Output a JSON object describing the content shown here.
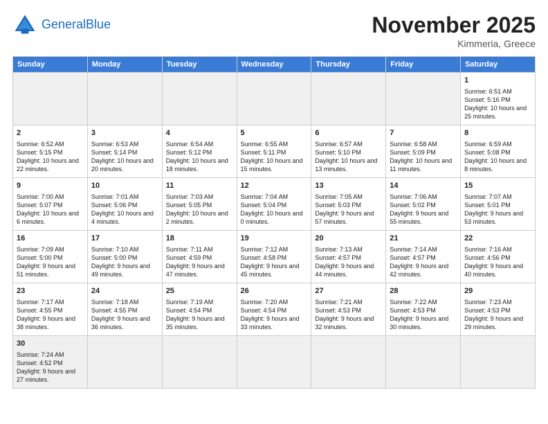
{
  "header": {
    "logo_general": "General",
    "logo_blue": "Blue",
    "month": "November 2025",
    "location": "Kimmeria, Greece"
  },
  "days_of_week": [
    "Sunday",
    "Monday",
    "Tuesday",
    "Wednesday",
    "Thursday",
    "Friday",
    "Saturday"
  ],
  "weeks": [
    [
      {
        "day": "",
        "info": "",
        "empty": true
      },
      {
        "day": "",
        "info": "",
        "empty": true
      },
      {
        "day": "",
        "info": "",
        "empty": true
      },
      {
        "day": "",
        "info": "",
        "empty": true
      },
      {
        "day": "",
        "info": "",
        "empty": true
      },
      {
        "day": "",
        "info": "",
        "empty": true
      },
      {
        "day": "1",
        "info": "Sunrise: 6:51 AM\nSunset: 5:16 PM\nDaylight: 10 hours\nand 25 minutes."
      }
    ],
    [
      {
        "day": "2",
        "info": "Sunrise: 6:52 AM\nSunset: 5:15 PM\nDaylight: 10 hours\nand 22 minutes."
      },
      {
        "day": "3",
        "info": "Sunrise: 6:53 AM\nSunset: 5:14 PM\nDaylight: 10 hours\nand 20 minutes."
      },
      {
        "day": "4",
        "info": "Sunrise: 6:54 AM\nSunset: 5:12 PM\nDaylight: 10 hours\nand 18 minutes."
      },
      {
        "day": "5",
        "info": "Sunrise: 6:55 AM\nSunset: 5:11 PM\nDaylight: 10 hours\nand 15 minutes."
      },
      {
        "day": "6",
        "info": "Sunrise: 6:57 AM\nSunset: 5:10 PM\nDaylight: 10 hours\nand 13 minutes."
      },
      {
        "day": "7",
        "info": "Sunrise: 6:58 AM\nSunset: 5:09 PM\nDaylight: 10 hours\nand 11 minutes."
      },
      {
        "day": "8",
        "info": "Sunrise: 6:59 AM\nSunset: 5:08 PM\nDaylight: 10 hours\nand 8 minutes."
      }
    ],
    [
      {
        "day": "9",
        "info": "Sunrise: 7:00 AM\nSunset: 5:07 PM\nDaylight: 10 hours\nand 6 minutes."
      },
      {
        "day": "10",
        "info": "Sunrise: 7:01 AM\nSunset: 5:06 PM\nDaylight: 10 hours\nand 4 minutes."
      },
      {
        "day": "11",
        "info": "Sunrise: 7:03 AM\nSunset: 5:05 PM\nDaylight: 10 hours\nand 2 minutes."
      },
      {
        "day": "12",
        "info": "Sunrise: 7:04 AM\nSunset: 5:04 PM\nDaylight: 10 hours\nand 0 minutes."
      },
      {
        "day": "13",
        "info": "Sunrise: 7:05 AM\nSunset: 5:03 PM\nDaylight: 9 hours\nand 57 minutes."
      },
      {
        "day": "14",
        "info": "Sunrise: 7:06 AM\nSunset: 5:02 PM\nDaylight: 9 hours\nand 55 minutes."
      },
      {
        "day": "15",
        "info": "Sunrise: 7:07 AM\nSunset: 5:01 PM\nDaylight: 9 hours\nand 53 minutes."
      }
    ],
    [
      {
        "day": "16",
        "info": "Sunrise: 7:09 AM\nSunset: 5:00 PM\nDaylight: 9 hours\nand 51 minutes."
      },
      {
        "day": "17",
        "info": "Sunrise: 7:10 AM\nSunset: 5:00 PM\nDaylight: 9 hours\nand 49 minutes."
      },
      {
        "day": "18",
        "info": "Sunrise: 7:11 AM\nSunset: 4:59 PM\nDaylight: 9 hours\nand 47 minutes."
      },
      {
        "day": "19",
        "info": "Sunrise: 7:12 AM\nSunset: 4:58 PM\nDaylight: 9 hours\nand 45 minutes."
      },
      {
        "day": "20",
        "info": "Sunrise: 7:13 AM\nSunset: 4:57 PM\nDaylight: 9 hours\nand 44 minutes."
      },
      {
        "day": "21",
        "info": "Sunrise: 7:14 AM\nSunset: 4:57 PM\nDaylight: 9 hours\nand 42 minutes."
      },
      {
        "day": "22",
        "info": "Sunrise: 7:16 AM\nSunset: 4:56 PM\nDaylight: 9 hours\nand 40 minutes."
      }
    ],
    [
      {
        "day": "23",
        "info": "Sunrise: 7:17 AM\nSunset: 4:55 PM\nDaylight: 9 hours\nand 38 minutes."
      },
      {
        "day": "24",
        "info": "Sunrise: 7:18 AM\nSunset: 4:55 PM\nDaylight: 9 hours\nand 36 minutes."
      },
      {
        "day": "25",
        "info": "Sunrise: 7:19 AM\nSunset: 4:54 PM\nDaylight: 9 hours\nand 35 minutes."
      },
      {
        "day": "26",
        "info": "Sunrise: 7:20 AM\nSunset: 4:54 PM\nDaylight: 9 hours\nand 33 minutes."
      },
      {
        "day": "27",
        "info": "Sunrise: 7:21 AM\nSunset: 4:53 PM\nDaylight: 9 hours\nand 32 minutes."
      },
      {
        "day": "28",
        "info": "Sunrise: 7:22 AM\nSunset: 4:53 PM\nDaylight: 9 hours\nand 30 minutes."
      },
      {
        "day": "29",
        "info": "Sunrise: 7:23 AM\nSunset: 4:53 PM\nDaylight: 9 hours\nand 29 minutes."
      }
    ],
    [
      {
        "day": "30",
        "info": "Sunrise: 7:24 AM\nSunset: 4:52 PM\nDaylight: 9 hours\nand 27 minutes.",
        "last": true
      },
      {
        "day": "",
        "info": "",
        "empty": true,
        "last": true
      },
      {
        "day": "",
        "info": "",
        "empty": true,
        "last": true
      },
      {
        "day": "",
        "info": "",
        "empty": true,
        "last": true
      },
      {
        "day": "",
        "info": "",
        "empty": true,
        "last": true
      },
      {
        "day": "",
        "info": "",
        "empty": true,
        "last": true
      },
      {
        "day": "",
        "info": "",
        "empty": true,
        "last": true
      }
    ]
  ]
}
